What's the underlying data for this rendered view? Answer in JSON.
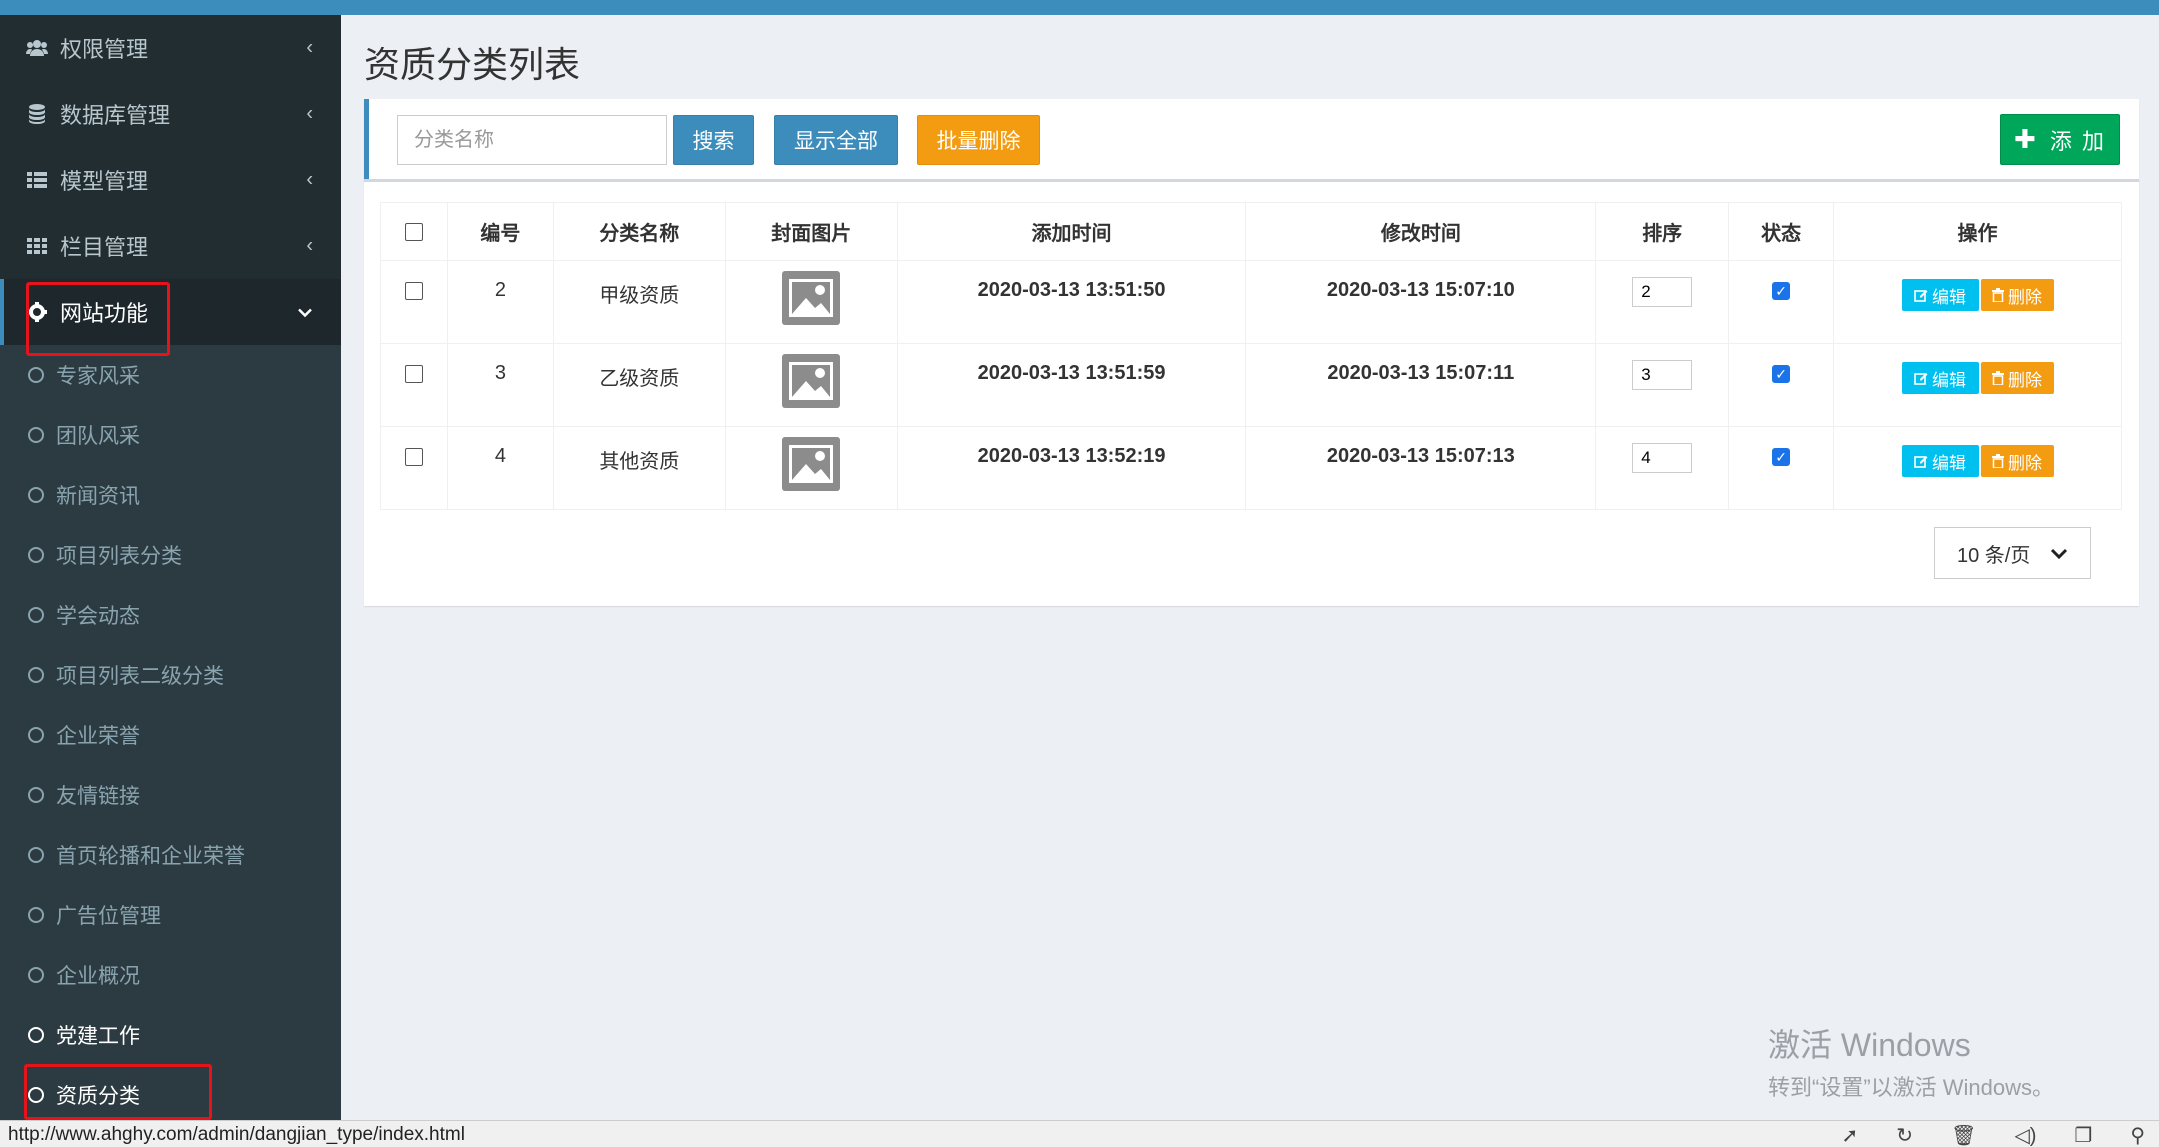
{
  "sidebar": {
    "menu": [
      {
        "label": "权限管理",
        "icon": "users-icon"
      },
      {
        "label": "数据库管理",
        "icon": "database-icon"
      },
      {
        "label": "模型管理",
        "icon": "list-icon"
      },
      {
        "label": "栏目管理",
        "icon": "grid-icon"
      },
      {
        "label": "网站功能",
        "icon": "gear-icon"
      }
    ],
    "submenu": [
      "专家风采",
      "团队风采",
      "新闻资讯",
      "项目列表分类",
      "学会动态",
      "项目列表二级分类",
      "企业荣誉",
      "友情链接",
      "首页轮播和企业荣誉",
      "广告位管理",
      "企业概况",
      "党建工作",
      "资质分类"
    ]
  },
  "page": {
    "title": "资质分类列表"
  },
  "toolbar": {
    "search_placeholder": "分类名称",
    "search_label": "搜索",
    "show_all_label": "显示全部",
    "batch_delete_label": "批量删除",
    "add_label": "添 加"
  },
  "table": {
    "headers": [
      "编号",
      "分类名称",
      "封面图片",
      "添加时间",
      "修改时间",
      "排序",
      "状态",
      "操作"
    ],
    "rows": [
      {
        "id": "2",
        "name": "甲级资质",
        "added": "2020-03-13 13:51:50",
        "modified": "2020-03-13 15:07:10",
        "sort": "2"
      },
      {
        "id": "3",
        "name": "乙级资质",
        "added": "2020-03-13 13:51:59",
        "modified": "2020-03-13 15:07:11",
        "sort": "3"
      },
      {
        "id": "4",
        "name": "其他资质",
        "added": "2020-03-13 13:52:19",
        "modified": "2020-03-13 15:07:13",
        "sort": "4"
      }
    ],
    "edit_label": "编辑",
    "delete_label": "删除"
  },
  "pager": {
    "per_page": "10 条/页"
  },
  "watermark": {
    "line1": "激活 Windows",
    "line2": "转到“设置”以激活 Windows。"
  },
  "statusbar": {
    "url": "http://www.ahghy.com/admin/dangjian_type/index.html"
  },
  "colors": {
    "primary": "#3c8dbc",
    "warning": "#f39c12",
    "success": "#00a65a",
    "info": "#00c0ef",
    "sidebar": "#222d32",
    "highlight": "#e6141a"
  }
}
